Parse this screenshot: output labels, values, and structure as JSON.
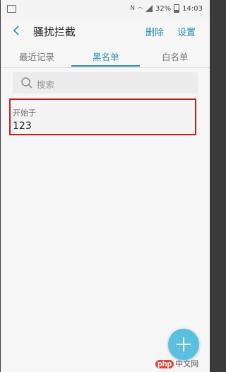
{
  "status_bar": {
    "battery": "32%",
    "time": "14:03"
  },
  "app_bar": {
    "title": "骚扰拦截",
    "delete_label": "删除",
    "settings_label": "设置"
  },
  "tabs": [
    {
      "label": "最近记录",
      "active": false
    },
    {
      "label": "黑名单",
      "active": true
    },
    {
      "label": "白名单",
      "active": false
    }
  ],
  "search": {
    "placeholder": "搜索"
  },
  "blacklist_items": [
    {
      "type_label": "开始于",
      "value": "123"
    }
  ],
  "colors": {
    "accent": "#2a8fb0",
    "fab": "#5bbfe0",
    "highlight_border": "#c02020"
  },
  "watermark": {
    "brand": "php",
    "text": "中文网"
  }
}
